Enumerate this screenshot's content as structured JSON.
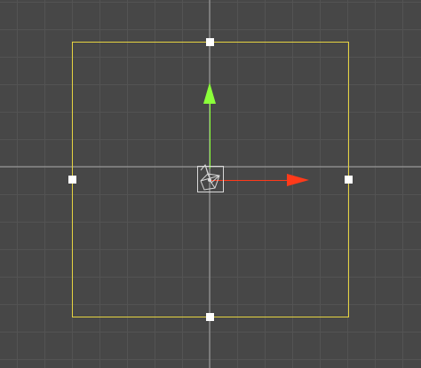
{
  "scene": {
    "background_color": "#474747",
    "grid_color": "#535353",
    "axis_line_color": "#a8a8a8"
  },
  "selection_rect": {
    "border_color": "#e5d341",
    "handle_color": "#ffffff",
    "handles": [
      "top-handle",
      "right-handle",
      "bottom-handle",
      "left-handle"
    ]
  },
  "move_gizmo": {
    "y_arrow_color": "#8bff3a",
    "x_arrow_color": "#ff3a1a",
    "y_icon": "arrow-up-icon",
    "x_icon": "arrow-right-icon"
  },
  "selected_object": {
    "icon": "camera-gizmo-icon",
    "outline_color": "#d8d8d8"
  }
}
